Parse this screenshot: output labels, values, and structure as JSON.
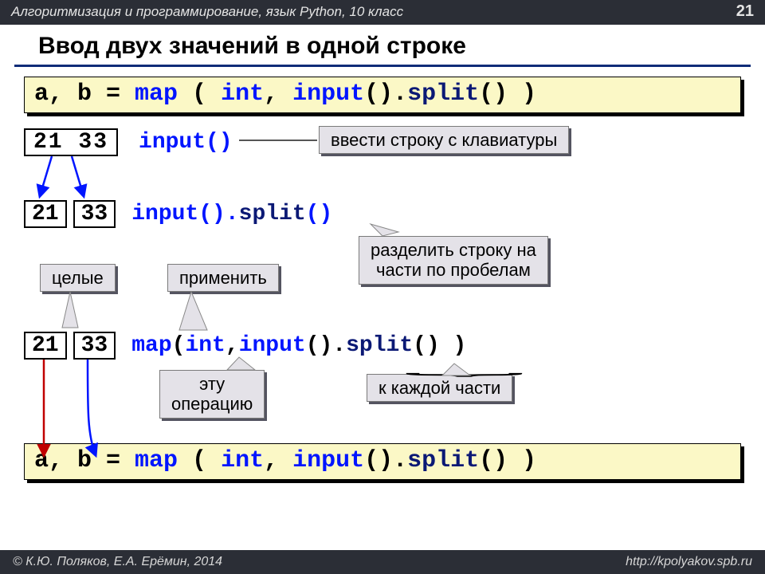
{
  "header": {
    "course": "Алгоритмизация и программирование, язык Python, 10 класс",
    "page": "21"
  },
  "title": "Ввод двух значений в одной строке",
  "code_main": {
    "lhs": "a, b = ",
    "map": "map",
    "paren1": " ( ",
    "int": "int",
    "comma": ", ",
    "input": "input",
    "call": "().",
    "split": "split",
    "tail": "() )"
  },
  "samples": {
    "joined": "21 33",
    "left": "21",
    "right": "33"
  },
  "exprs": {
    "e1": "input()",
    "e2a": "input().",
    "e2b": "split",
    "e2c": "()",
    "e3_map": "map",
    "e3_p": " ( ",
    "e3_int": "int",
    "e3_c": ", ",
    "e3_in": "input",
    "e3_dot": "().",
    "e3_sp": "split",
    "e3_tail": "() )"
  },
  "callouts": {
    "input": "ввести строку с клавиатуры",
    "split": "разделить строку на\nчасти по пробелам",
    "whole": "целые",
    "apply": "применить",
    "op": "эту\nоперацию",
    "each": "к каждой части"
  },
  "footer": {
    "left": "© К.Ю. Поляков, Е.А. Ерёмин, 2014",
    "right": "http://kpolyakov.spb.ru"
  }
}
